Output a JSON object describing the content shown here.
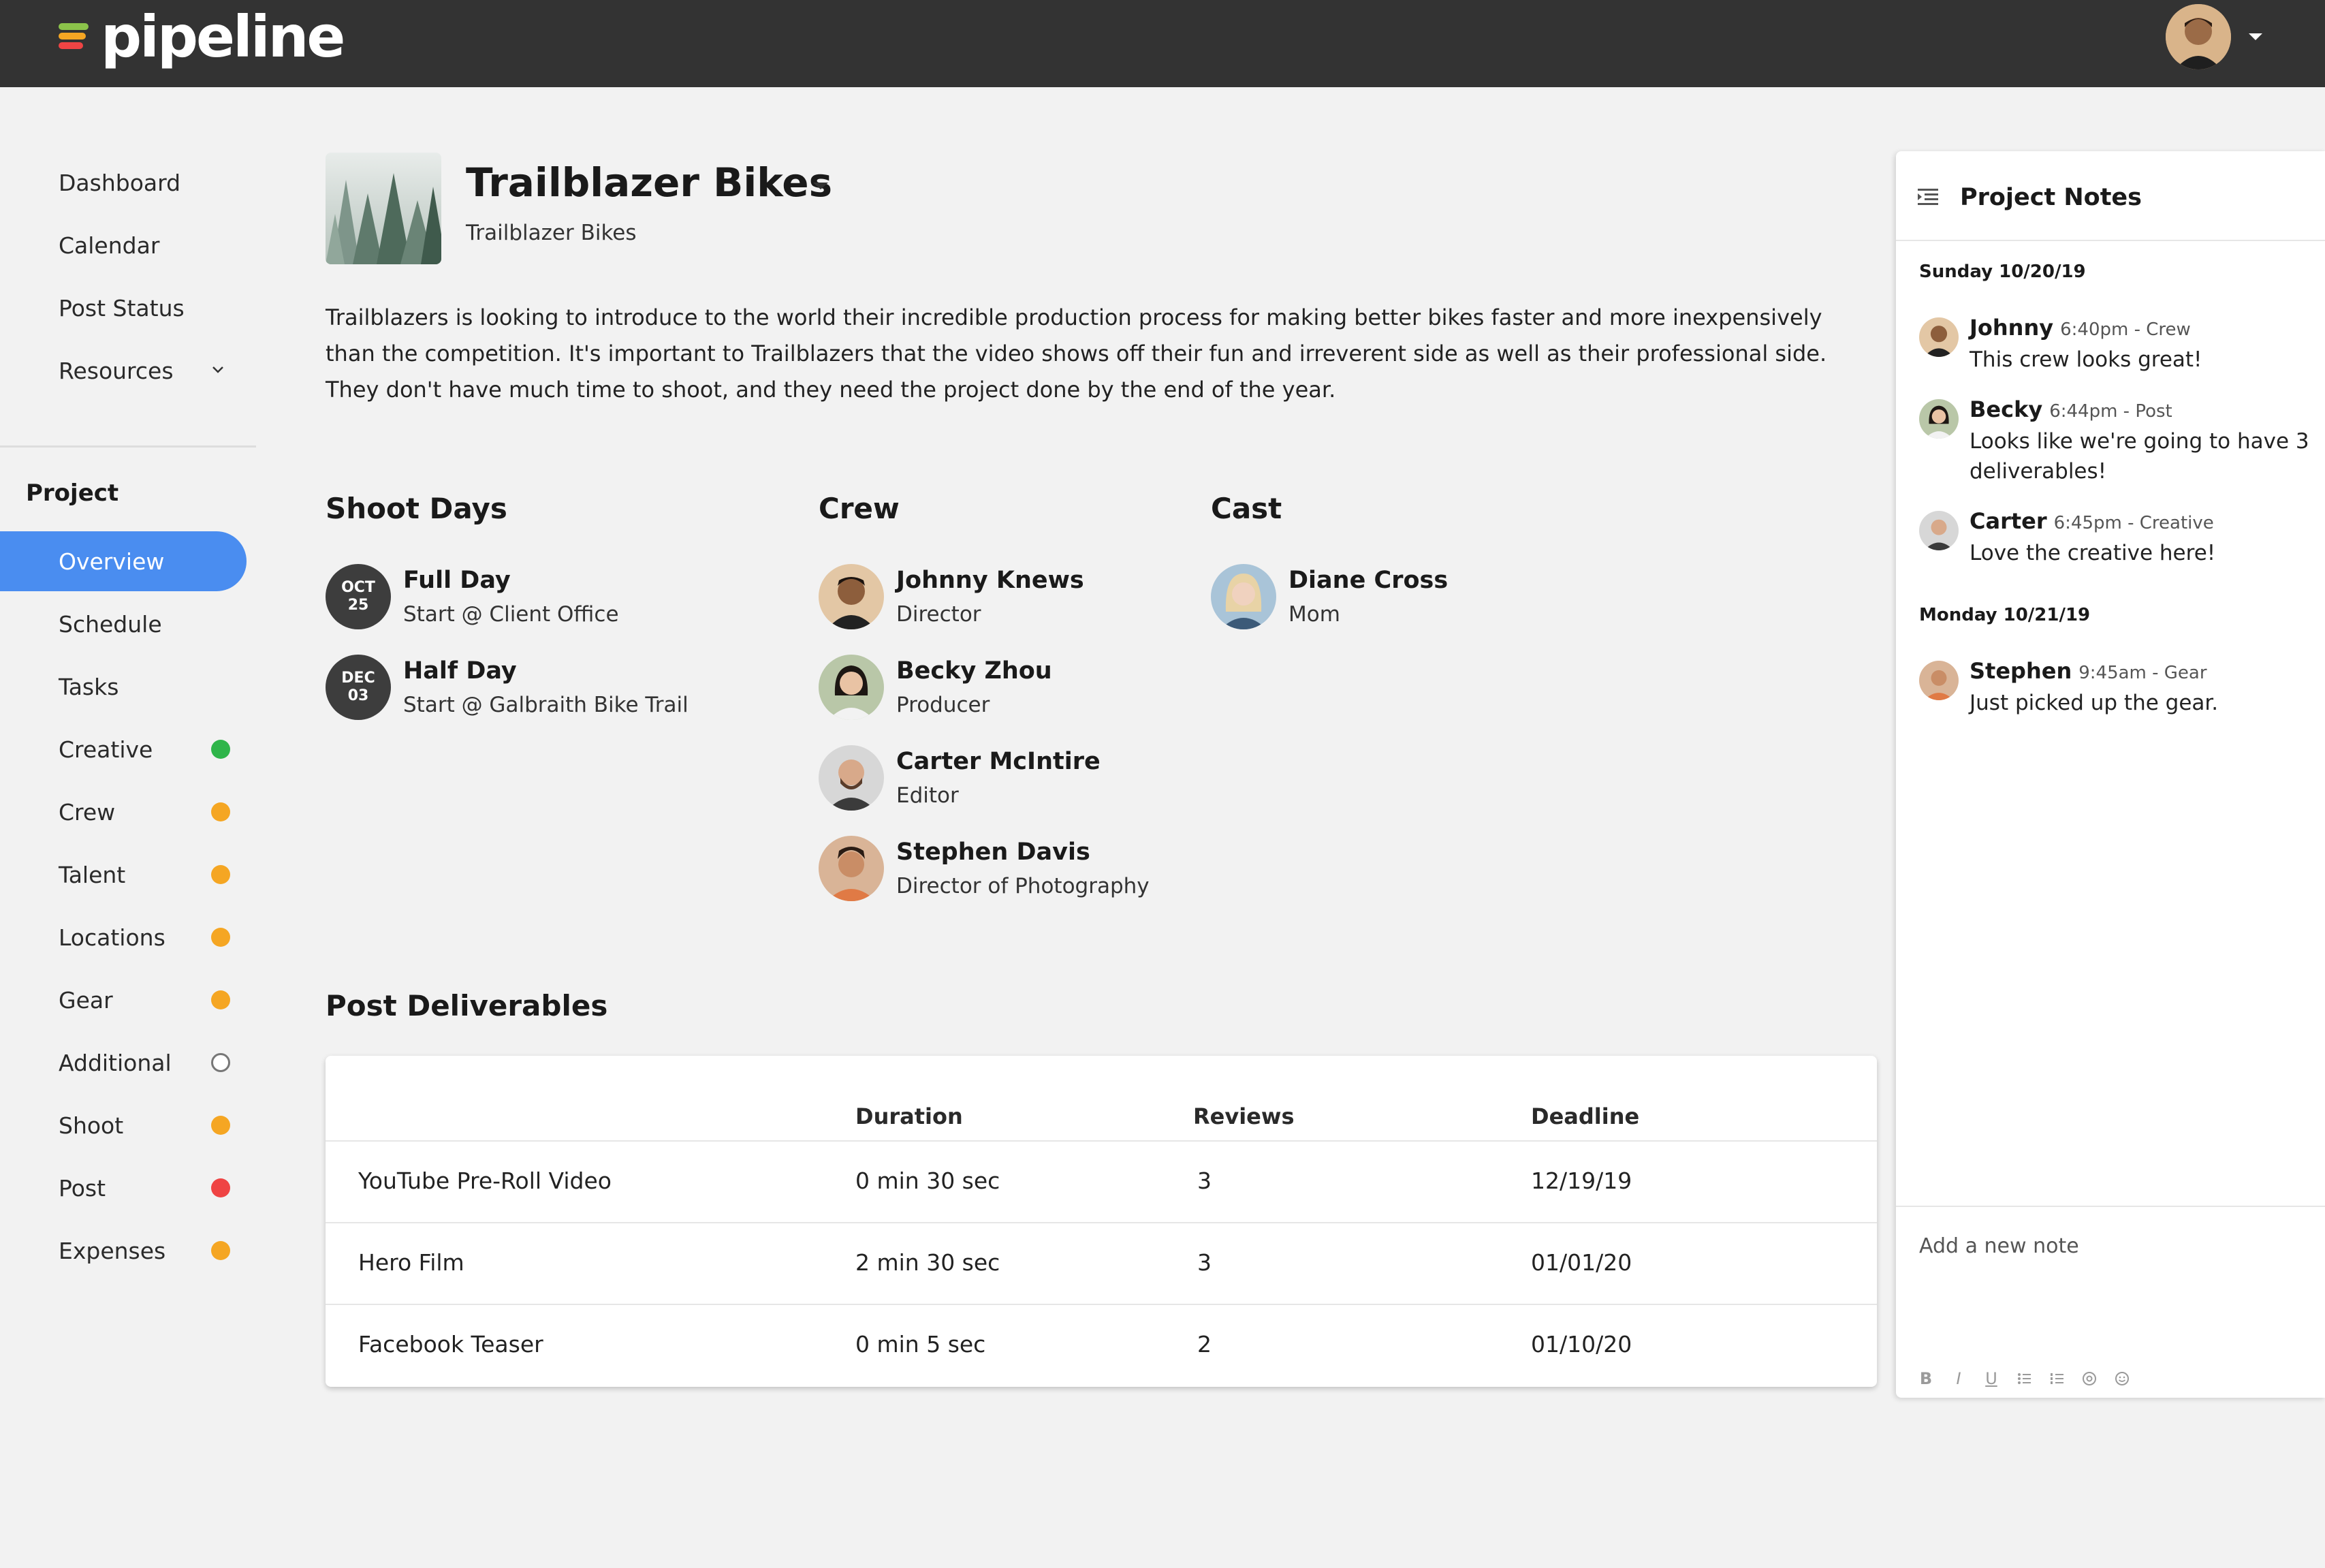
{
  "app": {
    "brand": "pipeline"
  },
  "sidebar": {
    "top_items": [
      {
        "label": "Dashboard"
      },
      {
        "label": "Calendar"
      },
      {
        "label": "Post Status"
      },
      {
        "label": "Resources"
      }
    ],
    "section_label": "Project",
    "project_items": [
      {
        "label": "Overview",
        "active": true
      },
      {
        "label": "Schedule"
      },
      {
        "label": "Tasks"
      },
      {
        "label": "Creative",
        "status": "#2fb54a"
      },
      {
        "label": "Crew",
        "status": "#f5a623"
      },
      {
        "label": "Talent",
        "status": "#f5a623"
      },
      {
        "label": "Locations",
        "status": "#f5a623"
      },
      {
        "label": "Gear",
        "status": "#f5a623"
      },
      {
        "label": "Additional",
        "status": "empty"
      },
      {
        "label": "Shoot",
        "status": "#f5a623"
      },
      {
        "label": "Post",
        "status": "#ef4444"
      },
      {
        "label": "Expenses",
        "status": "#f5a623"
      }
    ]
  },
  "project": {
    "title": "Trailblazer Bikes",
    "subtitle": "Trailblazer Bikes",
    "description": "Trailblazers is looking to introduce to the world their incredible production process for making better bikes faster and more inexpensively than the competition. It's important to Trailblazers that the video shows off their fun and irreverent side as well as their professional side. They don't have much time to shoot, and they need the project done by the end of the year."
  },
  "shoot_days": {
    "title": "Shoot Days",
    "items": [
      {
        "month": "OCT",
        "day": "25",
        "name": "Full Day",
        "detail": "Start @ Client Office"
      },
      {
        "month": "DEC",
        "day": "03",
        "name": "Half Day",
        "detail": "Start @ Galbraith Bike Trail"
      }
    ]
  },
  "crew": {
    "title": "Crew",
    "items": [
      {
        "name": "Johnny Knews",
        "role": "Director"
      },
      {
        "name": "Becky Zhou",
        "role": "Producer"
      },
      {
        "name": "Carter McIntire",
        "role": "Editor"
      },
      {
        "name": "Stephen Davis",
        "role": "Director of Photography"
      }
    ]
  },
  "cast": {
    "title": "Cast",
    "items": [
      {
        "name": "Diane Cross",
        "role": "Mom"
      }
    ]
  },
  "deliverables": {
    "title": "Post Deliverables",
    "columns": [
      "",
      "Duration",
      "Reviews",
      "Deadline"
    ],
    "rows": [
      [
        "YouTube Pre-Roll Video",
        "0 min 30 sec",
        "3",
        "12/19/19"
      ],
      [
        "Hero Film",
        "2 min 30 sec",
        "3",
        "01/01/20"
      ],
      [
        "Facebook Teaser",
        "0 min 5 sec",
        "2",
        "01/10/20"
      ]
    ]
  },
  "notes": {
    "title": "Project Notes",
    "day1": "Sunday 10/20/19",
    "day2": "Monday 10/21/19",
    "entries": [
      {
        "author": "Johnny",
        "meta": "6:40pm - Crew",
        "msg": "This crew looks great!"
      },
      {
        "author": "Becky",
        "meta": "6:44pm - Post",
        "msg": "Looks like we're going to have 3 deliverables!"
      },
      {
        "author": "Carter",
        "meta": "6:45pm - Creative",
        "msg": "Love the creative here!"
      },
      {
        "author": "Stephen",
        "meta": "9:45am - Gear",
        "msg": "Just picked up the gear."
      }
    ],
    "placeholder": "Add a new note",
    "toolbar": [
      "B",
      "I",
      "U"
    ]
  }
}
